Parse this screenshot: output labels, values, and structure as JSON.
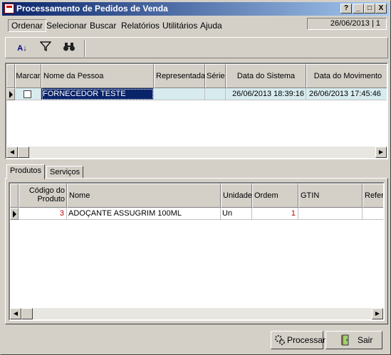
{
  "window": {
    "title": "Processamento de Pedidos de Venda",
    "help_btn": "?",
    "min_btn": "_",
    "max_btn": "□",
    "close_btn": "X"
  },
  "menu": {
    "items": [
      {
        "label": "Ordenar"
      },
      {
        "label": "Selecionar"
      },
      {
        "label": "Buscar"
      },
      {
        "label": "Relatórios"
      },
      {
        "label": "Utilitários"
      },
      {
        "label": "Ajuda"
      }
    ],
    "status": "26/06/2013 | 1"
  },
  "toolbar": {
    "sort_icon": "sort-az-icon",
    "filter_icon": "filter-icon",
    "find_icon": "binoculars-icon"
  },
  "people_grid": {
    "headers": [
      "Marcar",
      "Nome da Pessoa",
      "Representada",
      "Série",
      "Data do Sistema",
      "Data do Movimento"
    ],
    "rows": [
      {
        "marcar": "",
        "nome": "FORNECEDOR TESTE",
        "representada": "",
        "serie": "",
        "data_sistema": "26/06/2013 18:39:16",
        "data_movimento": "26/06/2013 17:45:46"
      }
    ]
  },
  "tabs": [
    {
      "label": "Produtos"
    },
    {
      "label": "Serviços"
    }
  ],
  "products_grid": {
    "headers": {
      "codigo_line1": "Código do",
      "codigo_line2": "Produto",
      "nome": "Nome",
      "unidade": "Unidade",
      "ordem": "Ordem",
      "gtin": "GTIN",
      "referencia": "Refere"
    },
    "rows": [
      {
        "codigo": "3",
        "nome": "ADOÇANTE ASSUGRIM 100ML",
        "unidade": "Un",
        "ordem": "1",
        "gtin": "",
        "referencia": ""
      }
    ]
  },
  "buttons": {
    "processar": "Processar",
    "sair": "Sair"
  },
  "colors": {
    "title_start": "#0a246a",
    "title_end": "#a6caf0",
    "selection": "#0a246a",
    "row_highlight": "#d8ecf0",
    "code_red": "#c00000"
  }
}
